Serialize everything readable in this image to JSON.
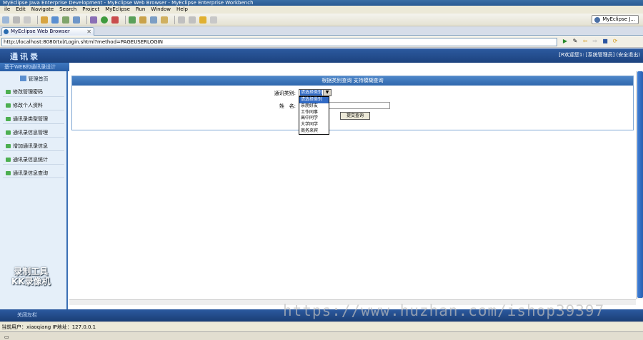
{
  "window": {
    "title": "MyEclipse Java Enterprise Development - MyEclipse Web Browser - MyEclipse Enterprise Workbench"
  },
  "menu": [
    "ile",
    "Edit",
    "Navigate",
    "Search",
    "Project",
    "MyEclipse",
    "Run",
    "Window",
    "Help"
  ],
  "perspective": {
    "label": "MyEclipse J..."
  },
  "editor_tab": {
    "label": "MyEclipse Web Browser",
    "close": "✕"
  },
  "browser": {
    "url": "http://localhost:8080/txl/Login.shtml?method=PAGEUSERLOGIN",
    "buttons": [
      "▶",
      "✎",
      "⇦",
      "⇨",
      "■",
      "⟳"
    ]
  },
  "app": {
    "logo": "通讯录",
    "subheader": "基于WEB的通讯录设计",
    "header_info": "[R欢迎您1: [系统管理员] (安全退出)",
    "sidebar_title": "管理首页",
    "sidebar_items": [
      "修改管理密码",
      "修改个人资料",
      "通讯录类型管理",
      "通讯录信息管理",
      "增加通讯录信息",
      "通讯录信息统计",
      "通讯录信息查询"
    ],
    "watermark_kk": [
      "录制工具",
      "KK录像机"
    ],
    "footer_left": "关闭左栏"
  },
  "search_panel": {
    "title": "根据类别查询 支持模糊查询",
    "type_label": "通讯类别:",
    "type_selected": "请选择类别",
    "type_options": [
      "请选择类别",
      "亲朋好友",
      "工作同事",
      "高中同学",
      "大学同学",
      "商务来宾"
    ],
    "name_label": "姓   名:",
    "name_value": "",
    "submit_label": "提交查询"
  },
  "status": {
    "text": "当前用户：xiaoqiang  IP地址：127.0.0.1"
  },
  "watermark_url": "https://www.huzhan.com/ishop39397"
}
